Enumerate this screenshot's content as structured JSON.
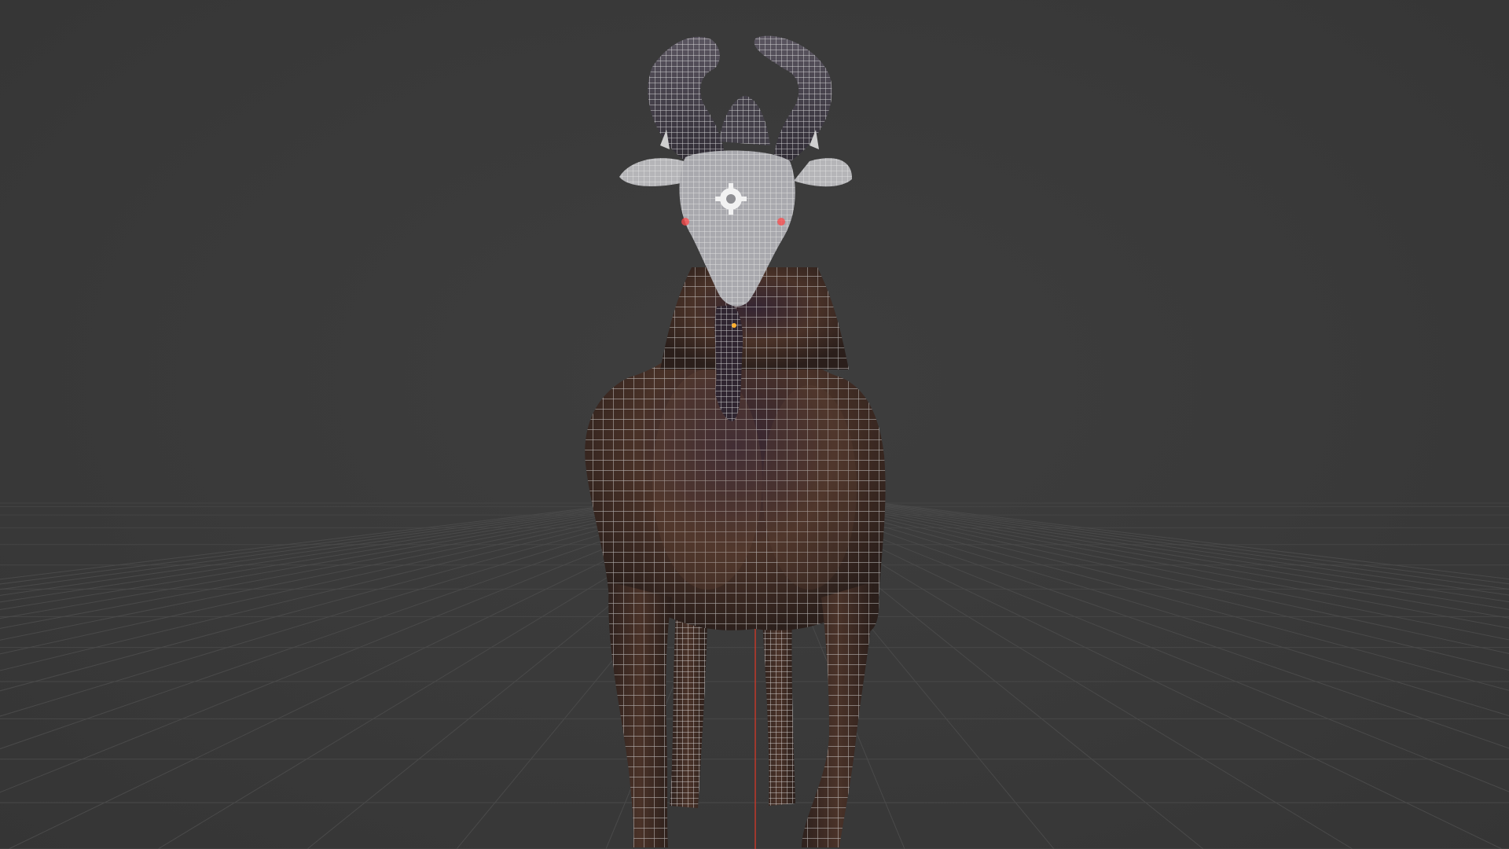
{
  "viewport": {
    "name": "3D viewport",
    "shading": "solid-with-wireframe-overlay",
    "background_color": "#3b3b3b",
    "grid_color": "#4a4a4a",
    "z_axis_color": "#c0392b"
  },
  "model": {
    "subject": "goat",
    "icons": [
      "origin-gear-icon"
    ],
    "colors": {
      "body": "#3a2a26",
      "body_highlight": "#6a4a3c",
      "wire": "#d8d8d8",
      "head_wire": "#e6e6e6",
      "eye": "#ff4a4a"
    }
  }
}
